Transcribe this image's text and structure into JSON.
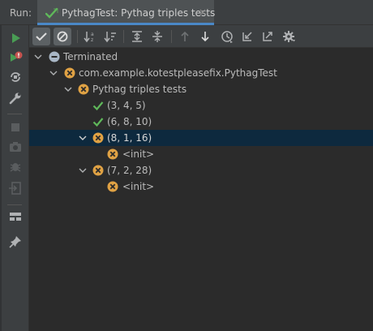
{
  "run_label": "Run:",
  "tab": {
    "title": "PythagTest: Pythag triples tests",
    "close": "×"
  },
  "left_toolbar": [
    "rerun-icon",
    "rerun-failed-icon",
    "toggle-auto-test-icon",
    "wrench-icon",
    "stop-icon",
    "camera-icon",
    "bug-icon",
    "exit-icon",
    "layout-icon",
    "pin-icon"
  ],
  "top_toolbar": [
    "show-passed-icon",
    "show-ignored-icon",
    "sort-alpha-icon",
    "sort-duration-icon",
    "expand-all-icon",
    "collapse-all-icon",
    "previous-failed-icon",
    "next-failed-icon",
    "history-icon",
    "import-tests-icon",
    "export-tests-icon",
    "settings-icon"
  ],
  "tree": {
    "root": "Terminated",
    "class_node": "com.example.kotestpleasefix.PythagTest",
    "suite": "Pythag triples tests",
    "items": [
      {
        "label": "(3, 4, 5)",
        "status": "passed"
      },
      {
        "label": "(6, 8, 10)",
        "status": "passed"
      },
      {
        "label": "(8, 1, 16)",
        "status": "failed",
        "child": "<init>"
      },
      {
        "label": "(7, 2, 28)",
        "status": "failed",
        "child": "<init>"
      }
    ]
  },
  "colors": {
    "pass": "#5fb85a",
    "fail": "#e0a244",
    "selection": "#0d293e",
    "accent": "#4a88c7"
  }
}
